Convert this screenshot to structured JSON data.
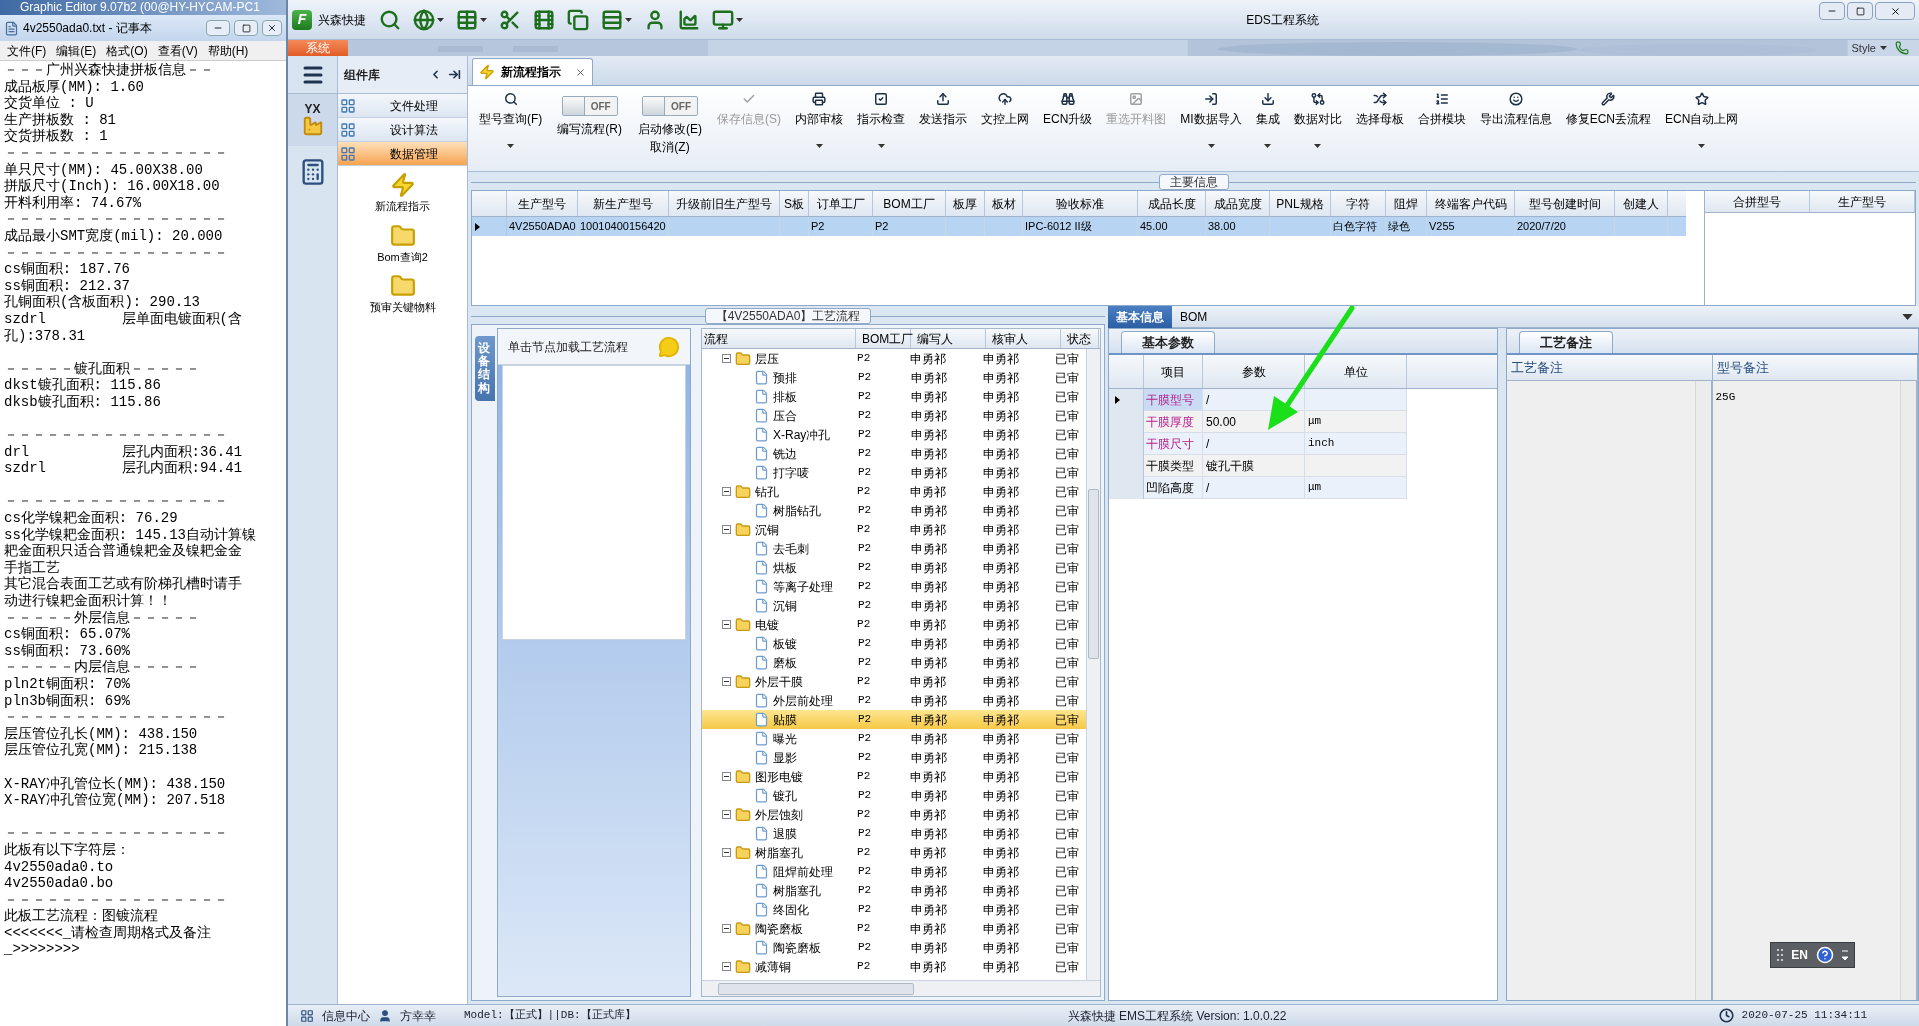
{
  "background_window": {
    "title": "Graphic Editor 9.07b2 (00@HY-HYCAM-PC1"
  },
  "notepad": {
    "title": "4v2550ada0.txt - 记事本",
    "menu": [
      "文件(F)",
      "编辑(E)",
      "格式(O)",
      "查看(V)",
      "帮助(H)"
    ],
    "blocks": [
      [
        "－－－广州兴森快捷拼板信息－－",
        "成品板厚(MM): 1.60",
        "交货单位 : U",
        "生产拼板数 : 81",
        "交货拼板数 : 1",
        "－－－－－－－－－－－－－－－－",
        "单只尺寸(MM): 45.00X38.00",
        "拼版尺寸(Inch): 16.00X18.00",
        "开料利用率: 74.67%",
        "－－－－－－－－－－－－－－－－",
        "成品最小SMT宽度(mil): 20.000",
        "－－－－－－－－－－－－－－－－",
        "cs铜面积: 187.76",
        "ss铜面积: 212.37",
        "孔铜面积(含板面积): 290.13",
        "szdrl         层单面电镀面积(含",
        "孔):378.31"
      ],
      [
        "－－－－－镀孔面积－－－－－",
        "dkst镀孔面积: 115.86",
        "dksb镀孔面积: 115.86"
      ],
      [
        "－－－－－－－－－－－－－－－－",
        "drl           层孔内面积:36.41",
        "szdrl         层孔内面积:94.41"
      ],
      [
        "－－－－－－－－－－－－－－－－",
        "cs化学镍耙金面积: 76.29",
        "ss化学镍耙金面积: 145.13自动计算镍",
        "耙金面积只适合普通镍耙金及镍耙金金",
        "手指工艺",
        "其它混合表面工艺或有阶梯孔槽时请手",
        "动进行镍耙金面积计算！！",
        "－－－－－外层信息－－－－－",
        "cs铜面积: 65.07%",
        "ss铜面积: 73.60%",
        "－－－－－内层信息－－－－－",
        "pln2t铜面积: 70%",
        "pln3b铜面积: 69%",
        "－－－－－－－－－－－－－－－－",
        "层压管位孔长(MM): 438.150",
        "层压管位孔宽(MM): 215.138"
      ],
      [
        "X-RAY冲孔管位长(MM): 438.150",
        "X-RAY冲孔管位宽(MM): 207.518"
      ],
      [
        "－－－－－－－－－－－－－－－－",
        "此板有以下字符层：",
        "4v2550ada0.to",
        "4v2550ada0.bo",
        "－－－－－－－－－－－－－－－－",
        "此板工艺流程：图镀流程",
        "<<<<<<<_请检查周期格式及备注",
        "_>>>>>>>>"
      ]
    ]
  },
  "app": {
    "logo": "F",
    "brand": "兴森快捷",
    "title": "EDS工程系统",
    "system_tab": "系统",
    "style_label": "Style"
  },
  "sidebar": {
    "badge": "YX",
    "title": "组件库",
    "groups": [
      {
        "label": "文件处理",
        "selected": false
      },
      {
        "label": "设计算法",
        "selected": false
      },
      {
        "label": "数据管理",
        "selected": true
      }
    ],
    "tools": [
      {
        "label": "新流程指示",
        "kind": "bolt"
      },
      {
        "label": "Bom查询2",
        "kind": "folder"
      },
      {
        "label": "预审关键物料",
        "kind": "folder"
      }
    ]
  },
  "document_tab": {
    "label": "新流程指示"
  },
  "ribbon": [
    {
      "kind": "button",
      "label": "型号查询(F)",
      "dropdown": true,
      "disabled": false
    },
    {
      "kind": "toggle",
      "label": "编写流程(R)",
      "on": false,
      "state_text": "OFF"
    },
    {
      "kind": "toggle",
      "label": "启动修改(E)",
      "sublabel": "取消(Z)",
      "on": false,
      "state_text": "OFF"
    },
    {
      "kind": "button",
      "label": "保存信息(S)",
      "dropdown": false,
      "disabled": true
    },
    {
      "kind": "button",
      "label": "内部审核",
      "dropdown": true,
      "disabled": false
    },
    {
      "kind": "button",
      "label": "指示检查",
      "dropdown": true,
      "disabled": false
    },
    {
      "kind": "button",
      "label": "发送指示",
      "dropdown": false,
      "disabled": false
    },
    {
      "kind": "button",
      "label": "文控上网",
      "dropdown": false,
      "disabled": false
    },
    {
      "kind": "button",
      "label": "ECN升级",
      "dropdown": false,
      "disabled": false
    },
    {
      "kind": "button",
      "label": "重选开料图",
      "dropdown": false,
      "disabled": true
    },
    {
      "kind": "button",
      "label": "MI数据导入",
      "dropdown": true,
      "disabled": false
    },
    {
      "kind": "button",
      "label": "集成",
      "dropdown": true,
      "disabled": false
    },
    {
      "kind": "button",
      "label": "数据对比",
      "dropdown": true,
      "disabled": false
    },
    {
      "kind": "button",
      "label": "选择母板",
      "dropdown": false,
      "disabled": false
    },
    {
      "kind": "button",
      "label": "合拼模块",
      "dropdown": false,
      "disabled": false
    },
    {
      "kind": "button",
      "label": "导出流程信息",
      "dropdown": false,
      "disabled": false
    },
    {
      "kind": "button",
      "label": "修复ECN丢流程",
      "dropdown": false,
      "disabled": false
    },
    {
      "kind": "button",
      "label": "ECN自动上网",
      "dropdown": true,
      "disabled": false
    }
  ],
  "main_info": {
    "title": "主要信息",
    "row_selected": true,
    "columns": [
      {
        "label": "生产型号",
        "value": "4V2550ADA0"
      },
      {
        "label": "新生产型号",
        "value": "10010400156420"
      },
      {
        "label": "升级前旧生产型号"
      },
      {
        "label": "S板"
      },
      {
        "label": "订单工厂",
        "value": "P2"
      },
      {
        "label": "BOM工厂",
        "value": "P2"
      },
      {
        "label": "板厚"
      },
      {
        "label": "板材"
      },
      {
        "label": "验收标准",
        "value": "IPC-6012 II级"
      },
      {
        "label": "成品长度",
        "value": "45.00"
      },
      {
        "label": "成品宽度",
        "value": "38.00"
      },
      {
        "label": "PNL规格"
      },
      {
        "label": "字符",
        "value": "白色字符"
      },
      {
        "label": "阻焊",
        "value": "绿色"
      },
      {
        "label": "终端客户代码",
        "value": "V255"
      },
      {
        "label": "型号创建时间",
        "value": "2020/7/20"
      },
      {
        "label": "创建人"
      }
    ],
    "side_columns": [
      "合拼型号",
      "生产型号"
    ]
  },
  "process": {
    "title": "【4V2550ADA0】工艺流程",
    "side_tab": "设备结构",
    "hint": "单击节点加载工艺流程",
    "columns": [
      "流程",
      "BOM工厂",
      "编写人",
      "核审人",
      "状态"
    ],
    "tree": [
      {
        "label": "层压",
        "expanded": true,
        "selected": false,
        "bom": "P2",
        "author": "申勇祁",
        "reviewer": "申勇祁",
        "status": "已审",
        "children": [
          {
            "label": "预排",
            "selected": false,
            "bom": "P2",
            "author": "申勇祁",
            "reviewer": "申勇祁",
            "status": "已审"
          },
          {
            "label": "排板",
            "selected": false,
            "bom": "P2",
            "author": "申勇祁",
            "reviewer": "申勇祁",
            "status": "已审"
          },
          {
            "label": "压合",
            "selected": false,
            "bom": "P2",
            "author": "申勇祁",
            "reviewer": "申勇祁",
            "status": "已审"
          },
          {
            "label": "X-Ray冲孔",
            "selected": false,
            "bom": "P2",
            "author": "申勇祁",
            "reviewer": "申勇祁",
            "status": "已审"
          },
          {
            "label": "铣边",
            "selected": false,
            "bom": "P2",
            "author": "申勇祁",
            "reviewer": "申勇祁",
            "status": "已审"
          },
          {
            "label": "打字唛",
            "selected": false,
            "bom": "P2",
            "author": "申勇祁",
            "reviewer": "申勇祁",
            "status": "已审"
          }
        ]
      },
      {
        "label": "钻孔",
        "expanded": true,
        "selected": false,
        "bom": "P2",
        "author": "申勇祁",
        "reviewer": "申勇祁",
        "status": "已审",
        "children": [
          {
            "label": "树脂钻孔",
            "selected": false,
            "bom": "P2",
            "author": "申勇祁",
            "reviewer": "申勇祁",
            "status": "已审"
          }
        ]
      },
      {
        "label": "沉铜",
        "expanded": true,
        "selected": false,
        "bom": "P2",
        "author": "申勇祁",
        "reviewer": "申勇祁",
        "status": "已审",
        "children": [
          {
            "label": "去毛刺",
            "selected": false,
            "bom": "P2",
            "author": "申勇祁",
            "reviewer": "申勇祁",
            "status": "已审"
          },
          {
            "label": "烘板",
            "selected": false,
            "bom": "P2",
            "author": "申勇祁",
            "reviewer": "申勇祁",
            "status": "已审"
          },
          {
            "label": "等离子处理",
            "selected": false,
            "bom": "P2",
            "author": "申勇祁",
            "reviewer": "申勇祁",
            "status": "已审"
          },
          {
            "label": "沉铜",
            "selected": false,
            "bom": "P2",
            "author": "申勇祁",
            "reviewer": "申勇祁",
            "status": "已审"
          }
        ]
      },
      {
        "label": "电镀",
        "expanded": true,
        "selected": false,
        "bom": "P2",
        "author": "申勇祁",
        "reviewer": "申勇祁",
        "status": "已审",
        "children": [
          {
            "label": "板镀",
            "selected": false,
            "bom": "P2",
            "author": "申勇祁",
            "reviewer": "申勇祁",
            "status": "已审"
          },
          {
            "label": "磨板",
            "selected": false,
            "bom": "P2",
            "author": "申勇祁",
            "reviewer": "申勇祁",
            "status": "已审"
          }
        ]
      },
      {
        "label": "外层干膜",
        "expanded": true,
        "selected": false,
        "bom": "P2",
        "author": "申勇祁",
        "reviewer": "申勇祁",
        "status": "已审",
        "children": [
          {
            "label": "外层前处理",
            "selected": false,
            "bom": "P2",
            "author": "申勇祁",
            "reviewer": "申勇祁",
            "status": "已审"
          },
          {
            "label": "贴膜",
            "selected": true,
            "bom": "P2",
            "author": "申勇祁",
            "reviewer": "申勇祁",
            "status": "已审"
          },
          {
            "label": "曝光",
            "selected": false,
            "bom": "P2",
            "author": "申勇祁",
            "reviewer": "申勇祁",
            "status": "已审"
          },
          {
            "label": "显影",
            "selected": false,
            "bom": "P2",
            "author": "申勇祁",
            "reviewer": "申勇祁",
            "status": "已审"
          }
        ]
      },
      {
        "label": "图形电镀",
        "expanded": true,
        "selected": false,
        "bom": "P2",
        "author": "申勇祁",
        "reviewer": "申勇祁",
        "status": "已审",
        "children": [
          {
            "label": "镀孔",
            "selected": false,
            "bom": "P2",
            "author": "申勇祁",
            "reviewer": "申勇祁",
            "status": "已审"
          }
        ]
      },
      {
        "label": "外层蚀刻",
        "expanded": true,
        "selected": false,
        "bom": "P2",
        "author": "申勇祁",
        "reviewer": "申勇祁",
        "status": "已审",
        "children": [
          {
            "label": "退膜",
            "selected": false,
            "bom": "P2",
            "author": "申勇祁",
            "reviewer": "申勇祁",
            "status": "已审"
          }
        ]
      },
      {
        "label": "树脂塞孔",
        "expanded": true,
        "selected": false,
        "bom": "P2",
        "author": "申勇祁",
        "reviewer": "申勇祁",
        "status": "已审",
        "children": [
          {
            "label": "阻焊前处理",
            "selected": false,
            "bom": "P2",
            "author": "申勇祁",
            "reviewer": "申勇祁",
            "status": "已审"
          },
          {
            "label": "树脂塞孔",
            "selected": false,
            "bom": "P2",
            "author": "申勇祁",
            "reviewer": "申勇祁",
            "status": "已审"
          },
          {
            "label": "终固化",
            "selected": false,
            "bom": "P2",
            "author": "申勇祁",
            "reviewer": "申勇祁",
            "status": "已审"
          }
        ]
      },
      {
        "label": "陶瓷磨板",
        "expanded": true,
        "selected": false,
        "bom": "P2",
        "author": "申勇祁",
        "reviewer": "申勇祁",
        "status": "已审",
        "children": [
          {
            "label": "陶瓷磨板",
            "selected": false,
            "bom": "P2",
            "author": "申勇祁",
            "reviewer": "申勇祁",
            "status": "已审"
          }
        ]
      },
      {
        "label": "减薄铜",
        "expanded": true,
        "selected": false,
        "bom": "P2",
        "author": "申勇祁",
        "reviewer": "申勇祁",
        "status": "已审"
      }
    ]
  },
  "details": {
    "tabs": [
      {
        "label": "基本信息",
        "selected": true
      },
      {
        "label": "BOM",
        "selected": false
      }
    ],
    "params": {
      "tab": "基本参数",
      "columns": [
        "项目",
        "参数",
        "单位"
      ],
      "rows": [
        {
          "item": "干膜型号",
          "value": "/",
          "required": true,
          "selected": true
        },
        {
          "item": "干膜厚度",
          "value": "50.00",
          "unit": "μm",
          "required": true,
          "selected": false
        },
        {
          "item": "干膜尺寸",
          "value": "/",
          "unit": "inch",
          "required": true,
          "selected": false
        },
        {
          "item": "干膜类型",
          "value": "镀孔干膜",
          "required": false,
          "selected": false
        },
        {
          "item": "凹陷高度",
          "value": "/",
          "unit": "μm",
          "required": false,
          "selected": false
        }
      ]
    },
    "notes": {
      "tab": "工艺备注",
      "columns": [
        {
          "label": "工艺备注"
        },
        {
          "label": "型号备注",
          "value": "25G"
        }
      ]
    }
  },
  "ime": {
    "label": "EN"
  },
  "status_bar": {
    "info": "信息中心",
    "user": "方幸幸",
    "model": "Model:【正式】||DB:【正式库】",
    "version": "兴森快捷 EMS工程系统 Version: 1.0.0.22",
    "time": "2020-07-25 11:34:11"
  }
}
